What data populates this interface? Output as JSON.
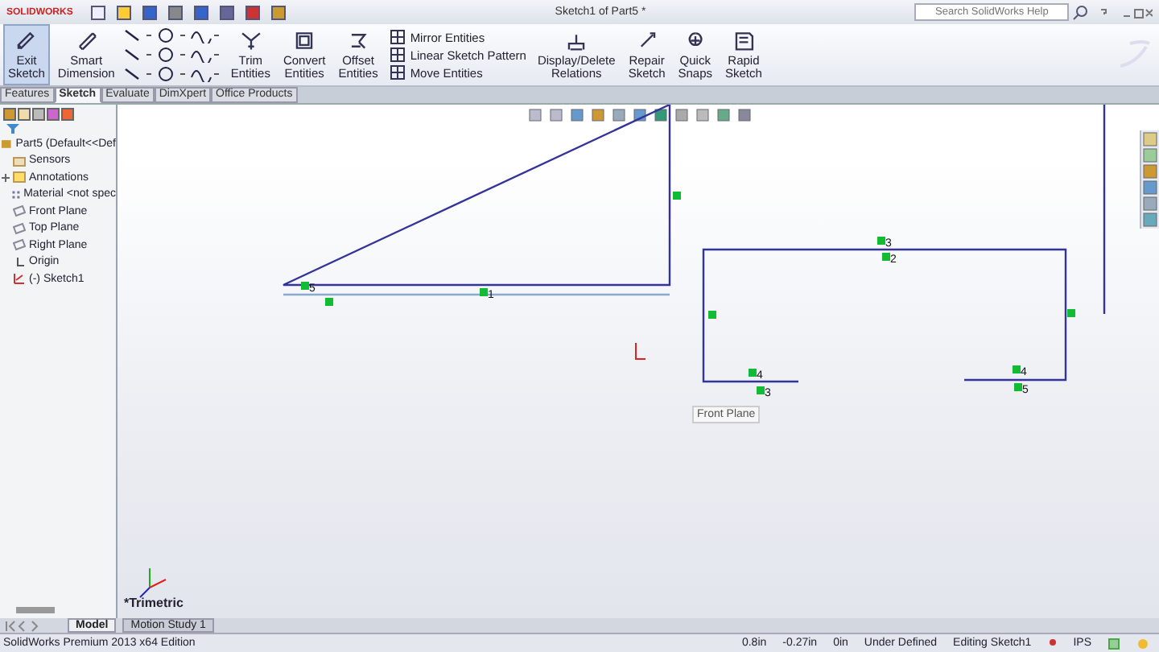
{
  "app": {
    "logo": "SOLIDWORKS",
    "title": "Sketch1 of Part5 *",
    "search": {
      "placeholder": "Search SolidWorks Help"
    }
  },
  "ribbon": [
    {
      "kind": "large",
      "label": "Exit Sketch",
      "selected": true
    },
    {
      "kind": "large",
      "label": "Smart Dimension",
      "selected": false
    },
    {
      "kind": "tools"
    },
    {
      "kind": "large",
      "label": "Trim Entities",
      "selected": false
    },
    {
      "kind": "large",
      "label": "Convert Entities",
      "selected": false
    },
    {
      "kind": "large",
      "label": "Offset Entities",
      "selected": false
    },
    {
      "kind": "list",
      "items": [
        "Mirror Entities",
        "Linear Sketch Pattern",
        "Move Entities"
      ]
    },
    {
      "kind": "large",
      "label": "Display/Delete Relations",
      "selected": false
    },
    {
      "kind": "large",
      "label": "Repair Sketch",
      "selected": false
    },
    {
      "kind": "large",
      "label": "Quick Snaps",
      "selected": false
    },
    {
      "kind": "large",
      "label": "Rapid Sketch",
      "selected": false
    }
  ],
  "tabs": [
    {
      "label": "Features",
      "selected": false
    },
    {
      "label": "Sketch",
      "selected": true
    },
    {
      "label": "Evaluate",
      "selected": false
    },
    {
      "label": "DimXpert",
      "selected": false
    },
    {
      "label": "Office Products",
      "selected": false
    }
  ],
  "tree": {
    "label": "Part5  (Default<<Def",
    "children": [
      {
        "kind": "folder",
        "label": "Sensors"
      },
      {
        "kind": "annotations",
        "label": "Annotations",
        "expanded": false
      },
      {
        "kind": "material",
        "label": "Material <not spec"
      },
      {
        "kind": "plane",
        "label": "Front Plane"
      },
      {
        "kind": "plane",
        "label": "Top Plane"
      },
      {
        "kind": "plane",
        "label": "Right Plane"
      },
      {
        "kind": "origin",
        "label": "Origin"
      },
      {
        "kind": "sketch",
        "label": "(-) Sketch1"
      }
    ]
  },
  "sketch": {
    "relations": [
      {
        "kind": "numbered",
        "label": "5"
      },
      {
        "kind": "numbered",
        "label": "1"
      },
      {
        "kind": "plain"
      },
      {
        "kind": "plain"
      },
      {
        "kind": "numbered",
        "label": "3"
      },
      {
        "kind": "numbered",
        "label": "2"
      },
      {
        "kind": "plain"
      },
      {
        "kind": "numbered",
        "label": "4"
      },
      {
        "kind": "numbered",
        "label": "3"
      },
      {
        "kind": "numbered",
        "label": "4"
      },
      {
        "kind": "numbered",
        "label": "5"
      },
      {
        "kind": "plain"
      }
    ],
    "tooltip": "Front Plane",
    "view": "*Trimetric"
  },
  "bottom_tabs": [
    {
      "label": "Model",
      "selected": true
    },
    {
      "label": "Motion Study 1",
      "selected": false
    }
  ],
  "status_bar": {
    "edition": "SolidWorks Premium 2013 x64 Edition",
    "x": "0.8in",
    "y": "-0.27in",
    "z": "0in",
    "state": "Under Defined",
    "mode": "Editing Sketch1",
    "units": "IPS"
  }
}
